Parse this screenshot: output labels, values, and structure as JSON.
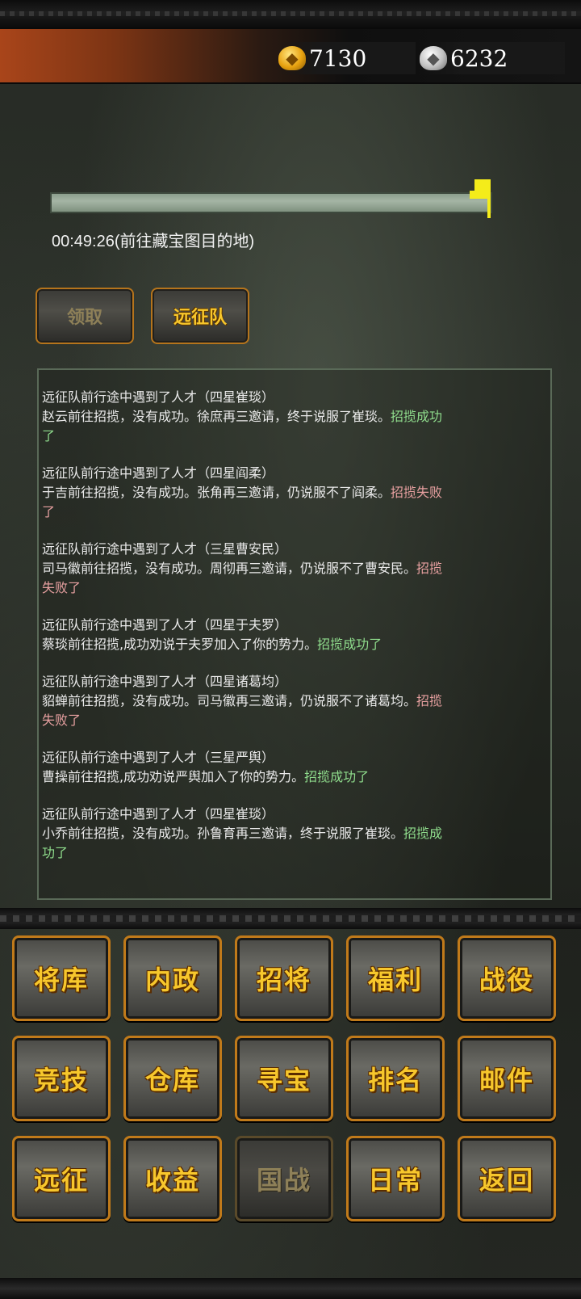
{
  "currency": {
    "gold_icon": "gold-ingot-icon",
    "gold_value": "7130",
    "silver_icon": "silver-ingot-icon",
    "silver_value": "6232"
  },
  "progress": {
    "fraction": 0.98,
    "timer_text": "00:49:26(前往藏宝图目的地)"
  },
  "actions": {
    "claim_label": "领取",
    "expedition_label": "远征队"
  },
  "log": [
    {
      "line1": "远征队前行途中遇到了人才（四星崔琰）",
      "line2": "赵云前往招揽，没有成功。徐庶再三邀请，终于说服了崔琰。",
      "result": "招揽成功了",
      "status": "success"
    },
    {
      "line1": "远征队前行途中遇到了人才（四星阎柔）",
      "line2": "于吉前往招揽，没有成功。张角再三邀请，仍说服不了阎柔。",
      "result": "招揽失败了",
      "status": "fail"
    },
    {
      "line1": "远征队前行途中遇到了人才（三星曹安民）",
      "line2": "司马徽前往招揽，没有成功。周彻再三邀请，仍说服不了曹安民。",
      "result": "招揽失败了",
      "status": "fail"
    },
    {
      "line1": "远征队前行途中遇到了人才（四星于夫罗）",
      "line2": "蔡琰前往招揽,成功劝说于夫罗加入了你的势力。",
      "result": "招揽成功了",
      "status": "success"
    },
    {
      "line1": "远征队前行途中遇到了人才（四星诸葛均）",
      "line2": "貂蝉前往招揽，没有成功。司马徽再三邀请，仍说服不了诸葛均。",
      "result": "招揽失败了",
      "status": "fail"
    },
    {
      "line1": "远征队前行途中遇到了人才（三星严舆）",
      "line2": "曹操前往招揽,成功劝说严舆加入了你的势力。",
      "result": "招揽成功了",
      "status": "success"
    },
    {
      "line1": "远征队前行途中遇到了人才（四星崔琰）",
      "line2": "小乔前往招揽，没有成功。孙鲁育再三邀请，终于说服了崔琰。",
      "result": "招揽成功了",
      "status": "success"
    }
  ],
  "menu": [
    {
      "label": "将库",
      "enabled": true
    },
    {
      "label": "内政",
      "enabled": true
    },
    {
      "label": "招将",
      "enabled": true
    },
    {
      "label": "福利",
      "enabled": true
    },
    {
      "label": "战役",
      "enabled": true
    },
    {
      "label": "竞技",
      "enabled": true
    },
    {
      "label": "仓库",
      "enabled": true
    },
    {
      "label": "寻宝",
      "enabled": true
    },
    {
      "label": "排名",
      "enabled": true
    },
    {
      "label": "邮件",
      "enabled": true
    },
    {
      "label": "远征",
      "enabled": true
    },
    {
      "label": "收益",
      "enabled": true
    },
    {
      "label": "国战",
      "enabled": false
    },
    {
      "label": "日常",
      "enabled": true
    },
    {
      "label": "返回",
      "enabled": true
    }
  ]
}
